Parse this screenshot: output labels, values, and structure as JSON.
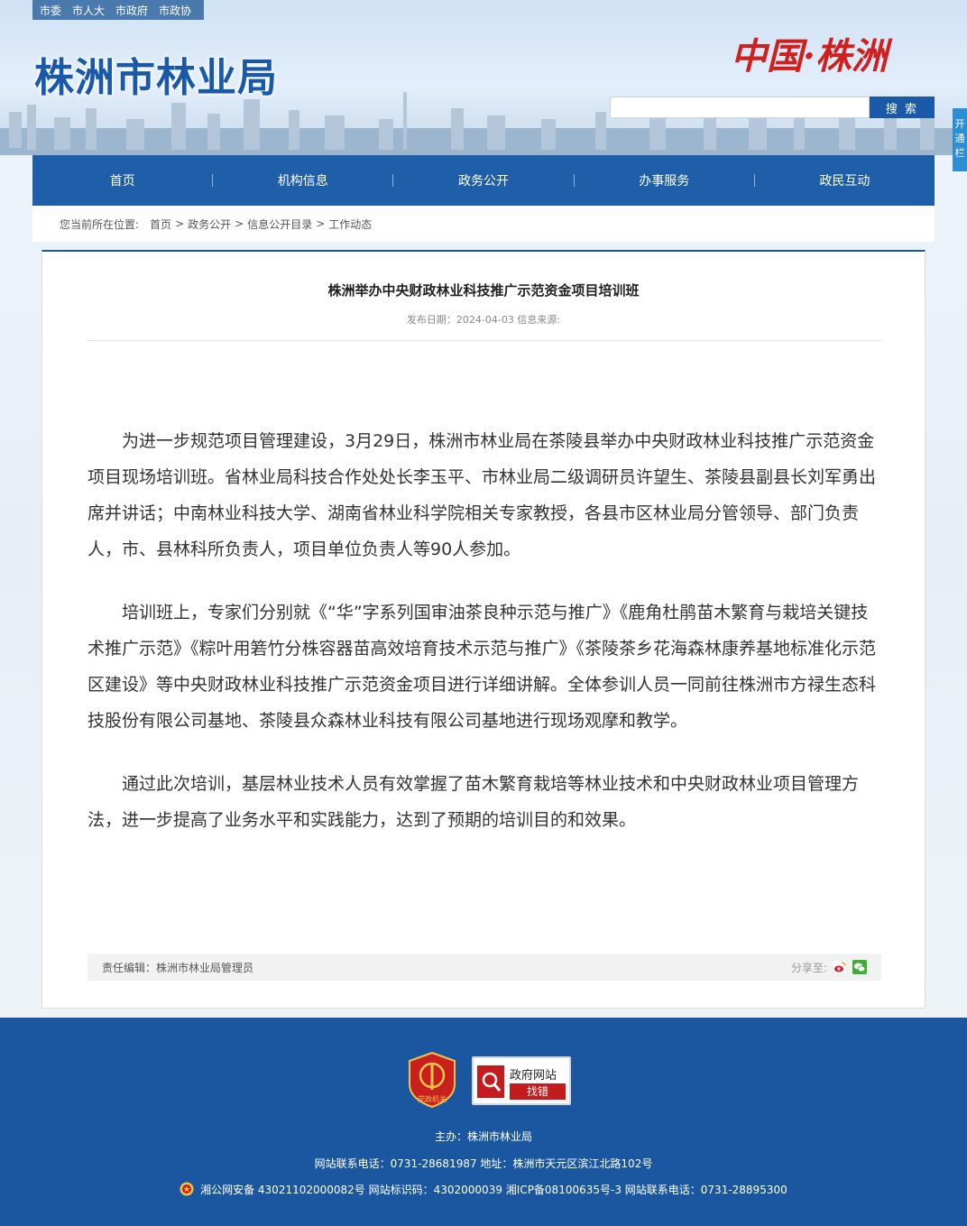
{
  "top_links": [
    "市委",
    "市人大",
    "市政府",
    "市政协"
  ],
  "site_title": "株洲市林业局",
  "brand_logo_text": "中国·株洲",
  "search": {
    "placeholder": "",
    "button": "搜 索"
  },
  "side_tab": "开通栏",
  "nav": [
    "首页",
    "机构信息",
    "政务公开",
    "办事服务",
    "政民互动"
  ],
  "breadcrumb": {
    "label": "您当前所在位置:",
    "items": [
      "首页",
      "政务公开",
      "信息公开目录",
      "工作动态"
    ]
  },
  "article": {
    "title": "株洲举办中央财政林业科技推广示范资金项目培训班",
    "meta": "发布日期：2024-04-03   信息来源:",
    "paragraphs": [
      "为进一步规范项目管理建设，3月29日，株洲市林业局在茶陵县举办中央财政林业科技推广示范资金项目现场培训班。省林业局科技合作处处长李玉平、市林业局二级调研员许望生、茶陵县副县长刘军勇出席并讲话；中南林业科技大学、湖南省林业科学院相关专家教授，各县市区林业局分管领导、部门负责人，市、县林科所负责人，项目单位负责人等90人参加。",
      "培训班上，专家们分别就《“华”字系列国审油茶良种示范与推广》《鹿角杜鹃苗木繁育与栽培关键技术推广示范》《粽叶用箬竹分株容器苗高效培育技术示范与推广》《茶陵茶乡花海森林康养基地标准化示范区建设》等中央财政林业科技推广示范资金项目进行详细讲解。全体参训人员一同前往株洲市方禄生态科技股份有限公司基地、茶陵县众森林业科技有限公司基地进行现场观摩和教学。",
      "通过此次培训，基层林业技术人员有效掌握了苗木繁育栽培等林业技术和中央财政林业项目管理方法，进一步提高了业务水平和实践能力，达到了预期的培训目的和效果。"
    ],
    "editor": "责任编辑：株洲市林业局管理员",
    "share_label": "分享至:"
  },
  "footer": {
    "party_badge": "党政机关",
    "find_mistake_top": "政府网站",
    "find_mistake_bottom": "找错",
    "host": "主办：株洲市林业局",
    "contact": "网站联系电话：0731-28681987 地址：株洲市天元区滨江北路102号",
    "record": "湘公网安备 43021102000082号 网站标识码：4302000039 湘ICP备08100635号-3 网站联系电话：0731-28895300"
  },
  "colors": {
    "primary": "#1f5fa9",
    "footer": "#1b57a0",
    "accent_red": "#c41c1c"
  }
}
